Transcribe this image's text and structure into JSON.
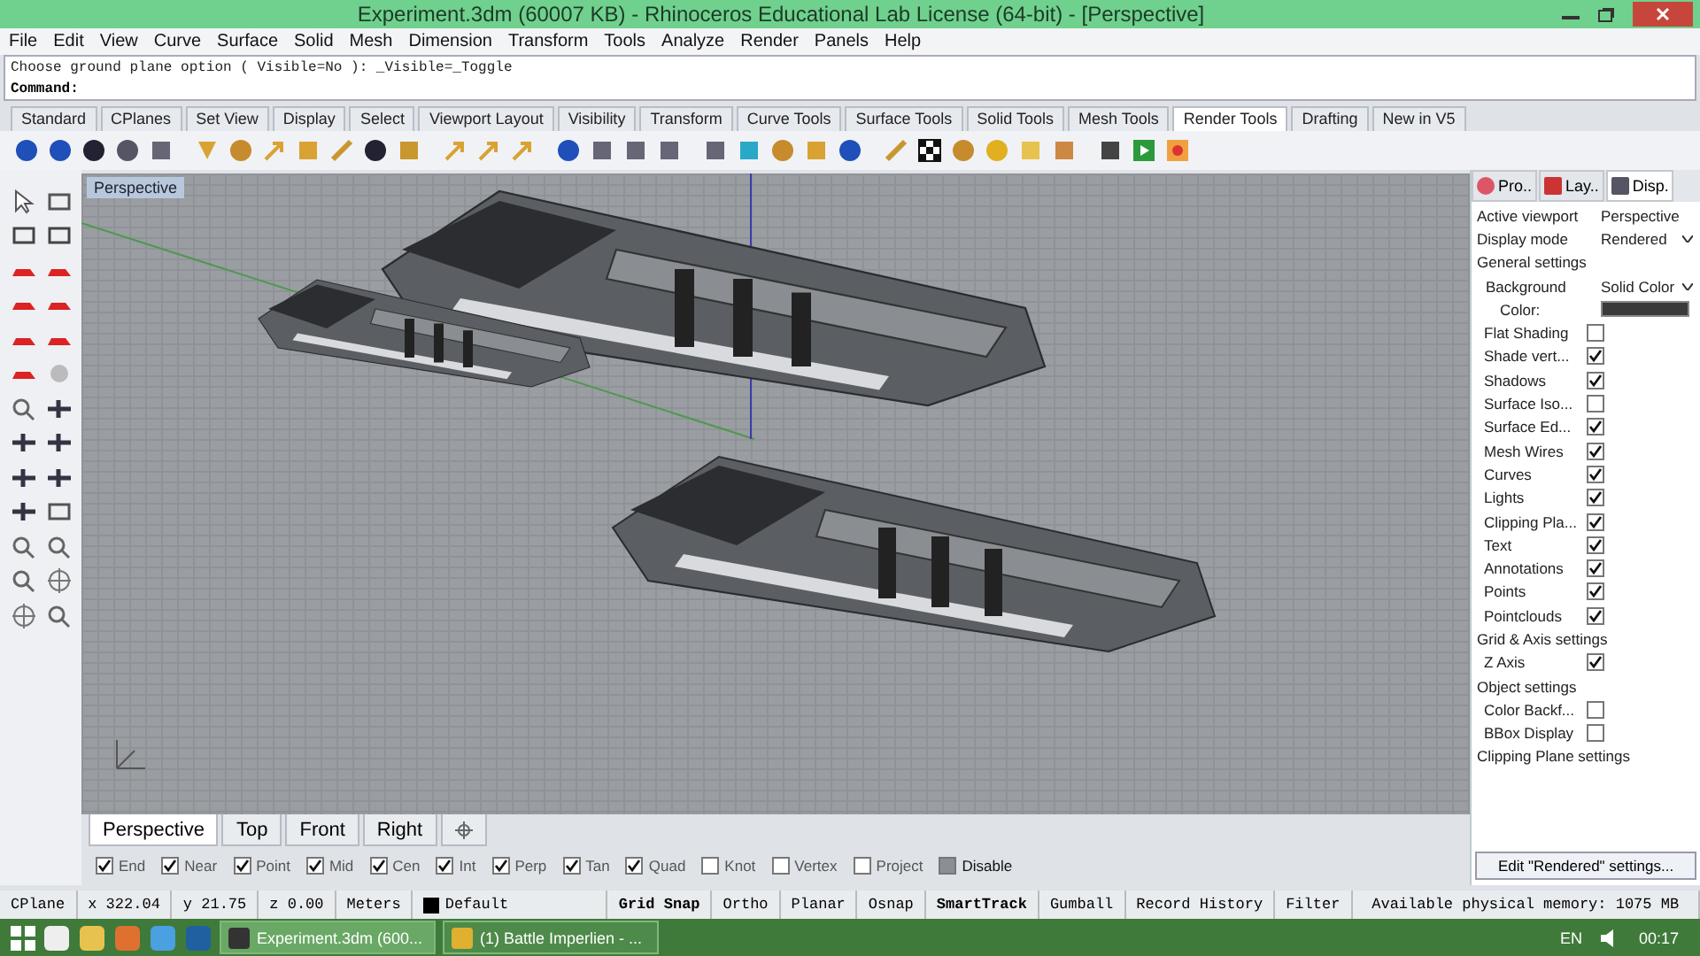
{
  "window": {
    "title": "Experiment.3dm (60007 KB) - Rhinoceros Educational Lab License (64-bit) - [Perspective]"
  },
  "menu": [
    "File",
    "Edit",
    "View",
    "Curve",
    "Surface",
    "Solid",
    "Mesh",
    "Dimension",
    "Transform",
    "Tools",
    "Analyze",
    "Render",
    "Panels",
    "Help"
  ],
  "command_history": "Choose ground plane option ( Visible=No ): _Visible=_Toggle",
  "command_prompt": "Command:",
  "toolbar_tabs": [
    {
      "label": "Standard",
      "selected": false
    },
    {
      "label": "CPlanes",
      "selected": false
    },
    {
      "label": "Set View",
      "selected": false
    },
    {
      "label": "Display",
      "selected": false
    },
    {
      "label": "Select",
      "selected": false
    },
    {
      "label": "Viewport Layout",
      "selected": false
    },
    {
      "label": "Visibility",
      "selected": false
    },
    {
      "label": "Transform",
      "selected": false
    },
    {
      "label": "Curve Tools",
      "selected": false
    },
    {
      "label": "Surface Tools",
      "selected": false
    },
    {
      "label": "Solid Tools",
      "selected": false
    },
    {
      "label": "Mesh Tools",
      "selected": false
    },
    {
      "label": "Render Tools",
      "selected": true
    },
    {
      "label": "Drafting",
      "selected": false
    },
    {
      "label": "New in V5",
      "selected": false
    }
  ],
  "viewport": {
    "label": "Perspective"
  },
  "viewport_tabs": [
    {
      "label": "Perspective",
      "selected": true
    },
    {
      "label": "Top",
      "selected": false
    },
    {
      "label": "Front",
      "selected": false
    },
    {
      "label": "Right",
      "selected": false
    }
  ],
  "panel_tabs": [
    {
      "label": "Pro..",
      "selected": false
    },
    {
      "label": "Lay..",
      "selected": false
    },
    {
      "label": "Disp.",
      "selected": true
    }
  ],
  "display_panel": [
    {
      "kind": "row",
      "label": "Active viewport",
      "value": "Perspective"
    },
    {
      "kind": "dropdown",
      "label": "Display mode",
      "value": "Rendered"
    },
    {
      "kind": "section",
      "label": "General settings"
    },
    {
      "kind": "dropdown",
      "label": "Background",
      "value": "Solid Color",
      "indented": true
    },
    {
      "kind": "color",
      "label": "Color:",
      "color": "#3a3a3a"
    },
    {
      "kind": "checkbox",
      "label": "Flat Shading",
      "checked": false
    },
    {
      "kind": "checkbox",
      "label": "Shade vert...",
      "checked": true
    },
    {
      "kind": "checkbox",
      "label": "Shadows",
      "checked": true
    },
    {
      "kind": "checkbox",
      "label": "Surface Iso...",
      "checked": false
    },
    {
      "kind": "checkbox",
      "label": "Surface Ed...",
      "checked": true
    },
    {
      "kind": "checkbox",
      "label": "Mesh Wires",
      "checked": true
    },
    {
      "kind": "checkbox",
      "label": "Curves",
      "checked": true
    },
    {
      "kind": "checkbox",
      "label": "Lights",
      "checked": true
    },
    {
      "kind": "checkbox",
      "label": "Clipping Pla...",
      "checked": true
    },
    {
      "kind": "checkbox",
      "label": "Text",
      "checked": true
    },
    {
      "kind": "checkbox",
      "label": "Annotations",
      "checked": true
    },
    {
      "kind": "checkbox",
      "label": "Points",
      "checked": true
    },
    {
      "kind": "checkbox",
      "label": "Pointclouds",
      "checked": true
    },
    {
      "kind": "section",
      "label": "Grid & Axis settings"
    },
    {
      "kind": "checkbox",
      "label": "Z Axis",
      "checked": true
    },
    {
      "kind": "section",
      "label": "Object settings"
    },
    {
      "kind": "checkbox",
      "label": "Color Backf...",
      "checked": false
    },
    {
      "kind": "checkbox",
      "label": "BBox Display",
      "checked": false
    },
    {
      "kind": "section",
      "label": "Clipping Plane settings"
    }
  ],
  "panel_button": "Edit \"Rendered\" settings...",
  "osnaps": [
    {
      "label": "End",
      "checked": true
    },
    {
      "label": "Near",
      "checked": true
    },
    {
      "label": "Point",
      "checked": true
    },
    {
      "label": "Mid",
      "checked": true
    },
    {
      "label": "Cen",
      "checked": true
    },
    {
      "label": "Int",
      "checked": true
    },
    {
      "label": "Perp",
      "checked": true
    },
    {
      "label": "Tan",
      "checked": true
    },
    {
      "label": "Quad",
      "checked": true
    },
    {
      "label": "Knot",
      "checked": false
    },
    {
      "label": "Vertex",
      "checked": false
    },
    {
      "label": "Project",
      "checked": false
    },
    {
      "label": "Disable",
      "checked": true,
      "kind": "filled"
    }
  ],
  "status_bar": [
    {
      "kind": "text",
      "label": "CPlane"
    },
    {
      "kind": "text",
      "label": "x 322.04"
    },
    {
      "kind": "text",
      "label": "y 21.75"
    },
    {
      "kind": "text",
      "label": "z 0.00"
    },
    {
      "kind": "text",
      "label": "Meters"
    },
    {
      "kind": "layer",
      "label": "Default",
      "color": "#000000"
    },
    {
      "kind": "toggle",
      "label": "Grid Snap",
      "on": true
    },
    {
      "kind": "toggle",
      "label": "Ortho",
      "on": false
    },
    {
      "kind": "toggle",
      "label": "Planar",
      "on": false
    },
    {
      "kind": "toggle",
      "label": "Osnap",
      "on": false
    },
    {
      "kind": "toggle",
      "label": "SmartTrack",
      "on": true
    },
    {
      "kind": "toggle",
      "label": "Gumball",
      "on": false
    },
    {
      "kind": "toggle",
      "label": "Record History",
      "on": false
    },
    {
      "kind": "toggle",
      "label": "Filter",
      "on": false
    },
    {
      "kind": "text",
      "label": "Available physical memory: 1075 MB"
    }
  ],
  "taskbar": {
    "windows": [
      {
        "label": "Experiment.3dm (600...",
        "selected": true
      },
      {
        "label": "(1) Battle Imperlien - ...",
        "selected": false
      }
    ],
    "language": "EN",
    "clock": "00:17"
  }
}
